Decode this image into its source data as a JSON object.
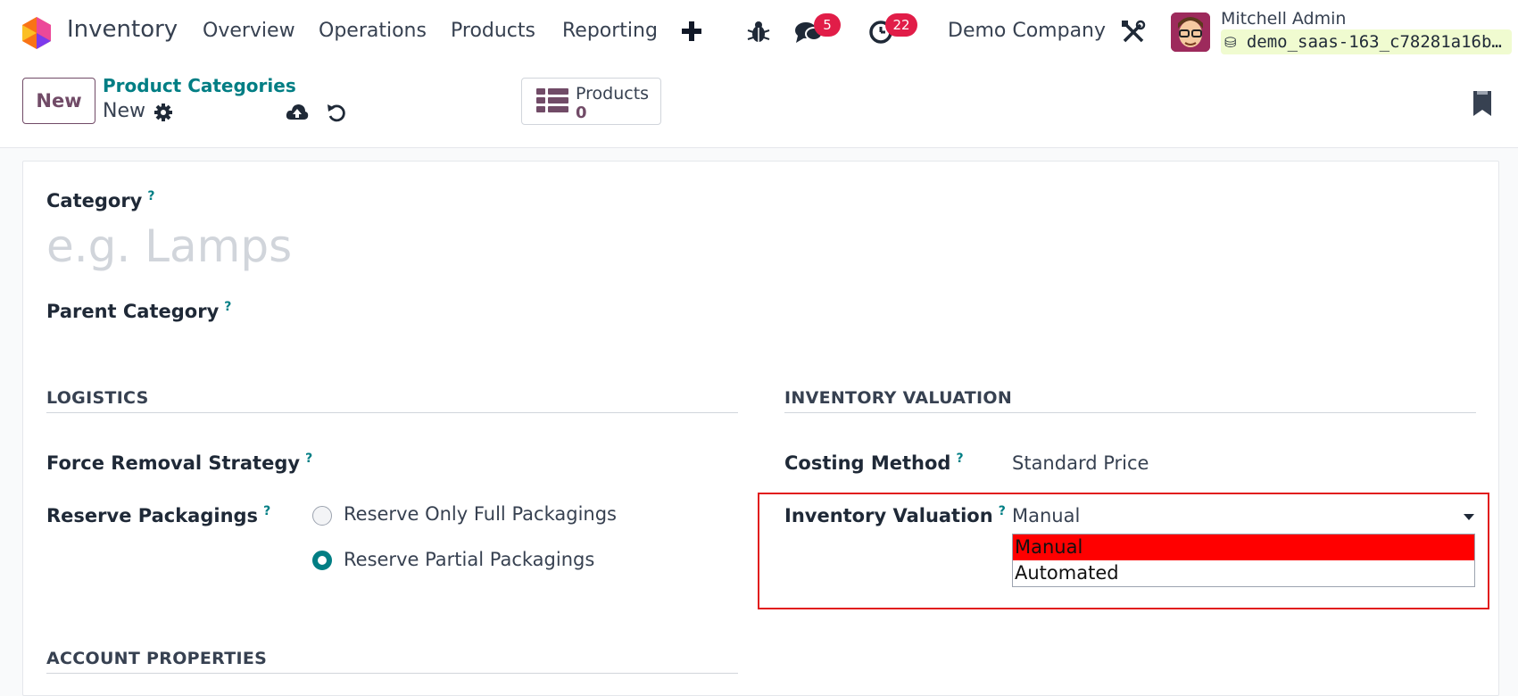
{
  "navbar": {
    "app_name": "Inventory",
    "menu": [
      "Overview",
      "Operations",
      "Products",
      "Reporting"
    ],
    "plus_label": "+",
    "messages_count": "5",
    "activities_count": "22",
    "company": "Demo Company",
    "user_name": "Mitchell Admin",
    "database": "demo_saas-163_c78281a16b…"
  },
  "control_panel": {
    "new_label": "New",
    "breadcrumb_parent": "Product Categories",
    "breadcrumb_current": "New",
    "smart_button_label": "Products",
    "smart_button_count": "0"
  },
  "form": {
    "category_label": "Category",
    "category_placeholder": "e.g. Lamps",
    "parent_category_label": "Parent Category",
    "help_mark": "?",
    "logistics": {
      "title": "LOGISTICS",
      "force_removal_label": "Force Removal Strategy",
      "reserve_packagings_label": "Reserve Packagings",
      "options": [
        "Reserve Only Full Packagings",
        "Reserve Partial Packagings"
      ],
      "selected_option": "Reserve Partial Packagings"
    },
    "valuation": {
      "title": "INVENTORY VALUATION",
      "costing_method_label": "Costing Method",
      "costing_method_value": "Standard Price",
      "inventory_valuation_label": "Inventory Valuation",
      "inventory_valuation_value": "Manual",
      "dropdown_options": [
        "Manual",
        "Automated"
      ],
      "highlighted_option": "Manual"
    },
    "account_properties_title": "ACCOUNT PROPERTIES"
  },
  "colors": {
    "brand": "#714b67",
    "accent": "#017e84",
    "badge": "#e11d48",
    "highlight_border": "#e11d1d",
    "option_highlight": "#ff0000"
  }
}
